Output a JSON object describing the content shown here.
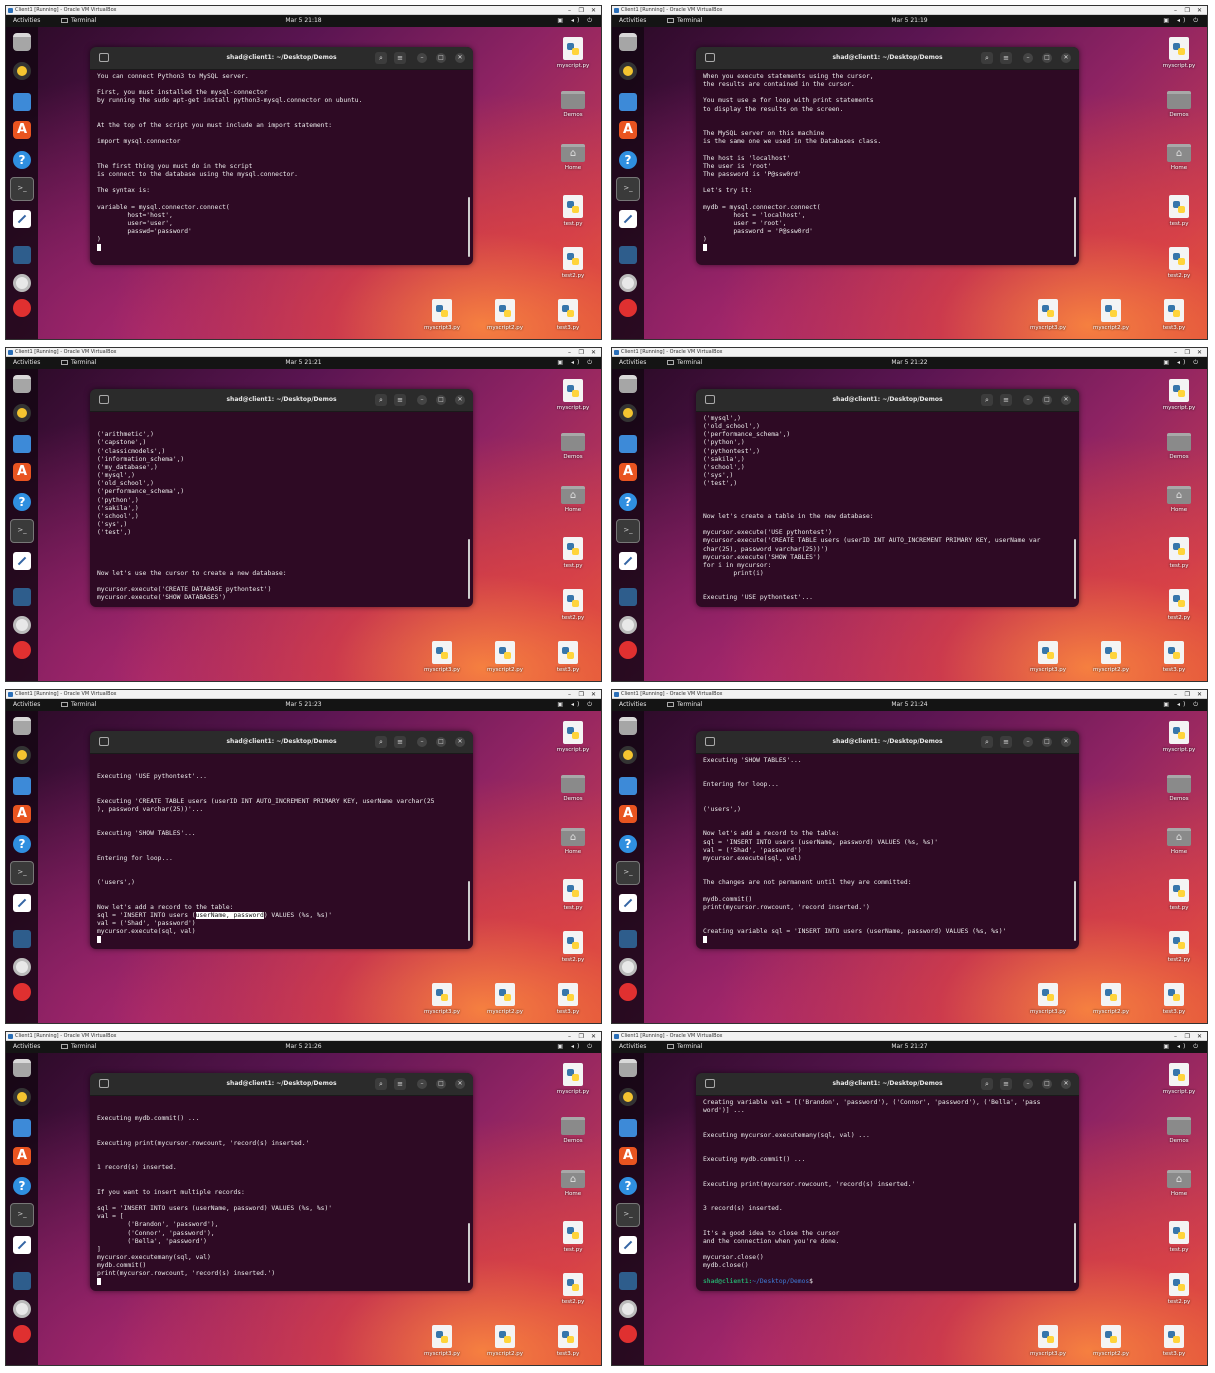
{
  "vbox": {
    "title": "Client1 [Running] - Oracle VM VirtualBox",
    "minimize": "–",
    "restore": "❐",
    "close": "✕"
  },
  "topbar": {
    "activities": "Activities",
    "app": "Terminal",
    "tray": "▣ ◂) ⏻"
  },
  "terminal": {
    "title": "shad@client1: ~/Desktop/Demos",
    "search_icon": "⌕",
    "menu_icon": "≡",
    "min_icon": "–",
    "max_icon": "□",
    "close_icon": "✕"
  },
  "dock": [
    "files-icon",
    "rhythmbox-icon",
    "writer-icon",
    "app-center-icon",
    "help-icon",
    "terminal-icon",
    "text-editor-icon",
    "workbench-icon",
    "disc-icon",
    "trash-icon"
  ],
  "desktop_icons": [
    {
      "label": "myscript.py",
      "kind": "py"
    },
    {
      "label": "Demos",
      "kind": "folder"
    },
    {
      "label": "Home",
      "kind": "home"
    },
    {
      "label": "test.py",
      "kind": "py"
    },
    {
      "label": "test2.py",
      "kind": "py"
    },
    {
      "label": "myscript3.py",
      "kind": "py"
    },
    {
      "label": "myscript2.py",
      "kind": "py"
    },
    {
      "label": "test3.py",
      "kind": "py"
    }
  ],
  "prompt": {
    "user": "shad@client1:",
    "path": "~/Desktop/Demos",
    "suffix": "$"
  },
  "frames": [
    {
      "clock": "Mar 5 21:18",
      "lines": [
        "You can connect Python3 to MySQL server.",
        "",
        "First, you must installed the mysql-connector",
        "by running the sudo apt-get install python3-mysql.connector on ubuntu.",
        "",
        "",
        "At the top of the script you must include an import statement:",
        "",
        "import mysql.connector",
        "",
        "",
        "The first thing you must do in the script",
        "is connect to the database using the mysql.connector.",
        "",
        "The syntax is:",
        "",
        "variable = mysql.connector.connect(",
        "        host='host',",
        "        user='user',",
        "        passwd='password'",
        ")"
      ]
    },
    {
      "clock": "Mar 5 21:19",
      "lines": [
        "When you execute statements using the cursor,",
        "the results are contained in the cursor.",
        "",
        "You must use a for loop with print statements",
        "to display the results on the screen.",
        "",
        "",
        "The MySQL server on this machine",
        "is the same one we used in the Databases class.",
        "",
        "The host is 'localhost'",
        "The user is 'root'",
        "The password is 'P@ssw0rd'",
        "",
        "Let's try it:",
        "",
        "mydb = mysql.connector.connect(",
        "        host = 'localhost',",
        "        user = 'root',",
        "        password = 'P@ssw0rd'",
        ")"
      ]
    },
    {
      "clock": "Mar 5 21:21",
      "lines": [
        "",
        "",
        "('arithmetic',)",
        "('capstone',)",
        "('classicmodels',)",
        "('information_schema',)",
        "('my_database',)",
        "('mysql',)",
        "('old_school',)",
        "('performance_schema',)",
        "('python',)",
        "('sakila',)",
        "('school',)",
        "('sys',)",
        "('test',)",
        "",
        "",
        "",
        "",
        "Now let's use the cursor to create a new database:",
        "",
        "mycursor.execute('CREATE DATABASE pythontest')",
        "mycursor.execute('SHOW DATABASES')",
        "for i in mycursor:",
        "        print(i)"
      ]
    },
    {
      "clock": "Mar 5 21:22",
      "lines": [
        "('mysql',)",
        "('old_school',)",
        "('performance_schema',)",
        "('python',)",
        "('pythontest',)",
        "('sakila',)",
        "('school',)",
        "('sys',)",
        "('test',)",
        "",
        "",
        "",
        "Now let's create a table in the new database:",
        "",
        "mycursor.execute('USE pythontest')",
        "mycursor.execute('CREATE TABLE users (userID INT AUTO_INCREMENT PRIMARY KEY, userName var",
        "char(25), password varchar(25))')",
        "mycursor.execute('SHOW TABLES')",
        "for i in mycursor:",
        "        print(i)",
        "",
        "",
        "Executing 'USE pythontest'..."
      ]
    },
    {
      "clock": "Mar 5 21:23",
      "lines": [
        "",
        "",
        "Executing 'USE pythontest'...",
        "",
        "",
        "Executing 'CREATE TABLE users (userID INT AUTO_INCREMENT PRIMARY KEY, userName varchar(25",
        "), password varchar(25))'...",
        "",
        "",
        "Executing 'SHOW TABLES'...",
        "",
        "",
        "Entering for loop...",
        "",
        "",
        "('users',)",
        "",
        "",
        "Now let's add a record to the table:",
        "sql = 'INSERT INTO users (userName, password) VALUES (%s, %s)'",
        "val = ('Shad', 'password')",
        "mycursor.execute(sql, val)"
      ]
    },
    {
      "clock": "Mar 5 21:24",
      "lines": [
        "Executing 'SHOW TABLES'...",
        "",
        "",
        "Entering for loop...",
        "",
        "",
        "('users',)",
        "",
        "",
        "Now let's add a record to the table:",
        "sql = 'INSERT INTO users (userName, password) VALUES (%s, %s)'",
        "val = ('Shad', 'password')",
        "mycursor.execute(sql, val)",
        "",
        "",
        "The changes are not permanent until they are committed:",
        "",
        "mydb.commit()",
        "print(mycursor.rowcount, 'record inserted.')",
        "",
        "",
        "Creating variable sql = 'INSERT INTO users (userName, password) VALUES (%s, %s)'"
      ]
    },
    {
      "clock": "Mar 5 21:26",
      "lines": [
        "",
        "",
        "Executing mydb.commit() ...",
        "",
        "",
        "Executing print(mycursor.rowcount, 'record(s) inserted.'",
        "",
        "",
        "1 record(s) inserted.",
        "",
        "",
        "If you want to insert multiple records:",
        "",
        "sql = 'INSERT INTO users (userName, password) VALUES (%s, %s)'",
        "val = [",
        "        ('Brandon', 'password'),",
        "        ('Connor', 'password'),",
        "        ('Bella', 'password')",
        "]",
        "mycursor.executemany(sql, val)",
        "mydb.commit()",
        "print(mycursor.rowcount, 'record(s) inserted.')"
      ]
    },
    {
      "clock": "Mar 5 21:27",
      "lines": [
        "Creating variable val = [('Brandon', 'password'), ('Connor', 'password'), ('Bella', 'pass",
        "word')] ...",
        "",
        "",
        "Executing mycursor.executemany(sql, val) ...",
        "",
        "",
        "Executing mydb.commit() ...",
        "",
        "",
        "Executing print(mycursor.rowcount, 'record(s) inserted.'",
        "",
        "",
        "3 record(s) inserted.",
        "",
        "",
        "It's a good idea to close the cursor",
        "and the connection when you're done.",
        "",
        "mycursor.close()",
        "mydb.close()",
        ""
      ]
    }
  ]
}
